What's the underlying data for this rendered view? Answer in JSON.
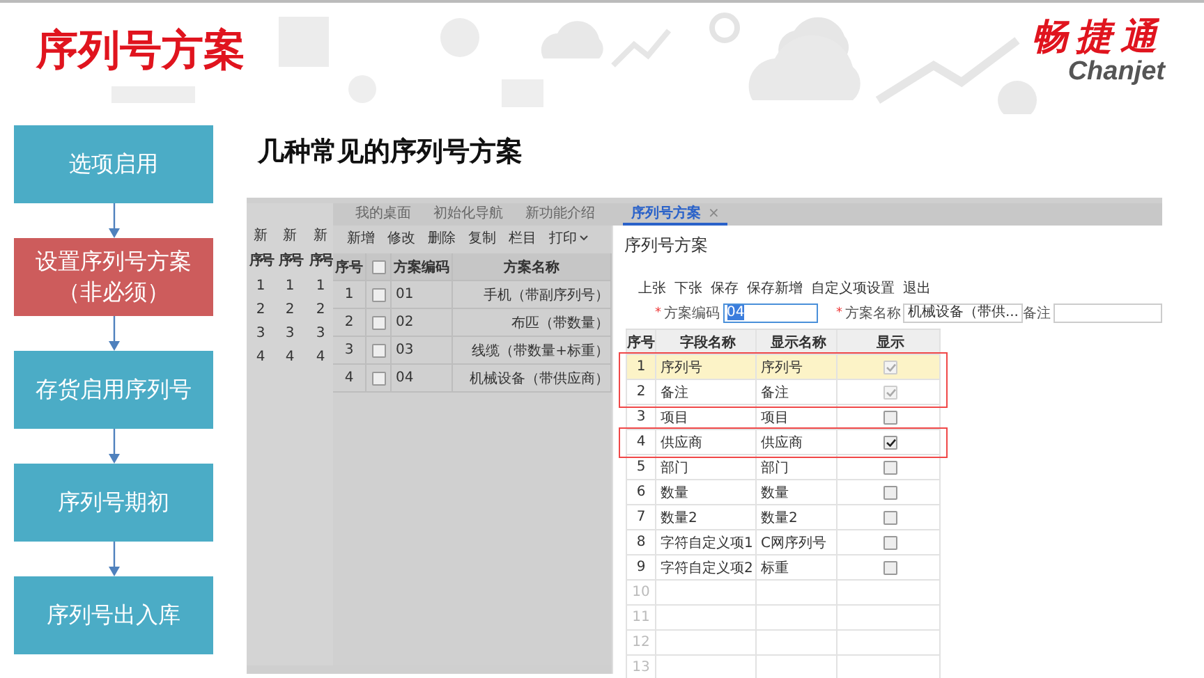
{
  "slide": {
    "title": "序列号方案",
    "logo": {
      "name": "畅捷通",
      "latin": "Chanjet"
    }
  },
  "steps": [
    {
      "label": "选项启用",
      "selected": false
    },
    {
      "label": "设置序列号方案（非必须）",
      "selected": true
    },
    {
      "label": "存货启用序列号",
      "selected": false
    },
    {
      "label": "序列号期初",
      "selected": false
    },
    {
      "label": "序列号出入库",
      "selected": false
    }
  ],
  "heading": "几种常见的序列号方案",
  "screenshot": {
    "back_windows": [
      {
        "tab": "新",
        "header": "序号",
        "rows": [
          "1",
          "2",
          "3",
          "4"
        ]
      },
      {
        "tab": "新",
        "header": "序号",
        "rows": [
          "1",
          "2",
          "3",
          "4"
        ]
      },
      {
        "tab": "新",
        "header": "序号",
        "rows": [
          "1",
          "2",
          "3",
          "4"
        ]
      }
    ],
    "main_window": {
      "tabs": [
        {
          "label": "我的桌面",
          "selected": false
        },
        {
          "label": "初始化导航",
          "selected": false
        },
        {
          "label": "新功能介绍",
          "selected": false
        },
        {
          "label": "序列号方案",
          "selected": true,
          "close": "×"
        }
      ],
      "toolbar": [
        {
          "label": "新增",
          "dropdown": false
        },
        {
          "label": "修改",
          "dropdown": false
        },
        {
          "label": "删除",
          "dropdown": false
        },
        {
          "label": "复制",
          "dropdown": false
        },
        {
          "label": "栏目",
          "dropdown": false
        },
        {
          "label": "打印",
          "dropdown": true
        }
      ],
      "table": {
        "columns": [
          "序号",
          "方案编码",
          "方案名称"
        ],
        "all_checked": false,
        "rows": [
          {
            "no": "1",
            "checked": false,
            "code": "01",
            "name": "手机（带副序列号）"
          },
          {
            "no": "2",
            "checked": false,
            "code": "02",
            "name": "布匹（带数量）"
          },
          {
            "no": "3",
            "checked": false,
            "code": "03",
            "name": "线缆（带数量+标重）"
          },
          {
            "no": "4",
            "checked": false,
            "code": "04",
            "name": "机械设备（带供应商）"
          }
        ]
      }
    },
    "dialog": {
      "title": "序列号方案",
      "toolbar": [
        "上张",
        "下张",
        "保存",
        "保存新增",
        "自定义项设置",
        "退出"
      ],
      "fields": [
        {
          "label": "方案编码",
          "required_mark": "*",
          "value": "04",
          "text_selected": true
        },
        {
          "label": "方案名称",
          "required_mark": "*",
          "value": "机械设备（带供...",
          "text_selected": false
        },
        {
          "label": "备注"
        }
      ],
      "table": {
        "columns": [
          "序号",
          "字段名称",
          "显示名称",
          "显示"
        ],
        "rows": [
          {
            "no": "1",
            "field": "序列号",
            "display": "序列号",
            "checked": true,
            "disabled": true,
            "selected": true,
            "marked": true
          },
          {
            "no": "2",
            "field": "备注",
            "display": "备注",
            "checked": true,
            "disabled": true,
            "selected": false,
            "marked": true
          },
          {
            "no": "3",
            "field": "项目",
            "display": "项目",
            "checked": false,
            "disabled": false,
            "selected": false,
            "marked": false
          },
          {
            "no": "4",
            "field": "供应商",
            "display": "供应商",
            "checked": true,
            "disabled": false,
            "selected": false,
            "marked": true
          },
          {
            "no": "5",
            "field": "部门",
            "display": "部门",
            "checked": false,
            "disabled": false,
            "selected": false,
            "marked": false
          },
          {
            "no": "6",
            "field": "数量",
            "display": "数量",
            "checked": false,
            "disabled": false,
            "selected": false,
            "marked": false
          },
          {
            "no": "7",
            "field": "数量2",
            "display": "数量2",
            "checked": false,
            "disabled": false,
            "selected": false,
            "marked": false
          },
          {
            "no": "8",
            "field": "字符自定义项1",
            "display": "C网序列号",
            "checked": false,
            "disabled": false,
            "selected": false,
            "marked": false
          },
          {
            "no": "9",
            "field": "字符自定义项2",
            "display": "标重",
            "checked": false,
            "disabled": false,
            "selected": false,
            "marked": false
          },
          {
            "no": "10"
          },
          {
            "no": "11"
          },
          {
            "no": "12"
          },
          {
            "no": "13"
          }
        ]
      }
    }
  }
}
